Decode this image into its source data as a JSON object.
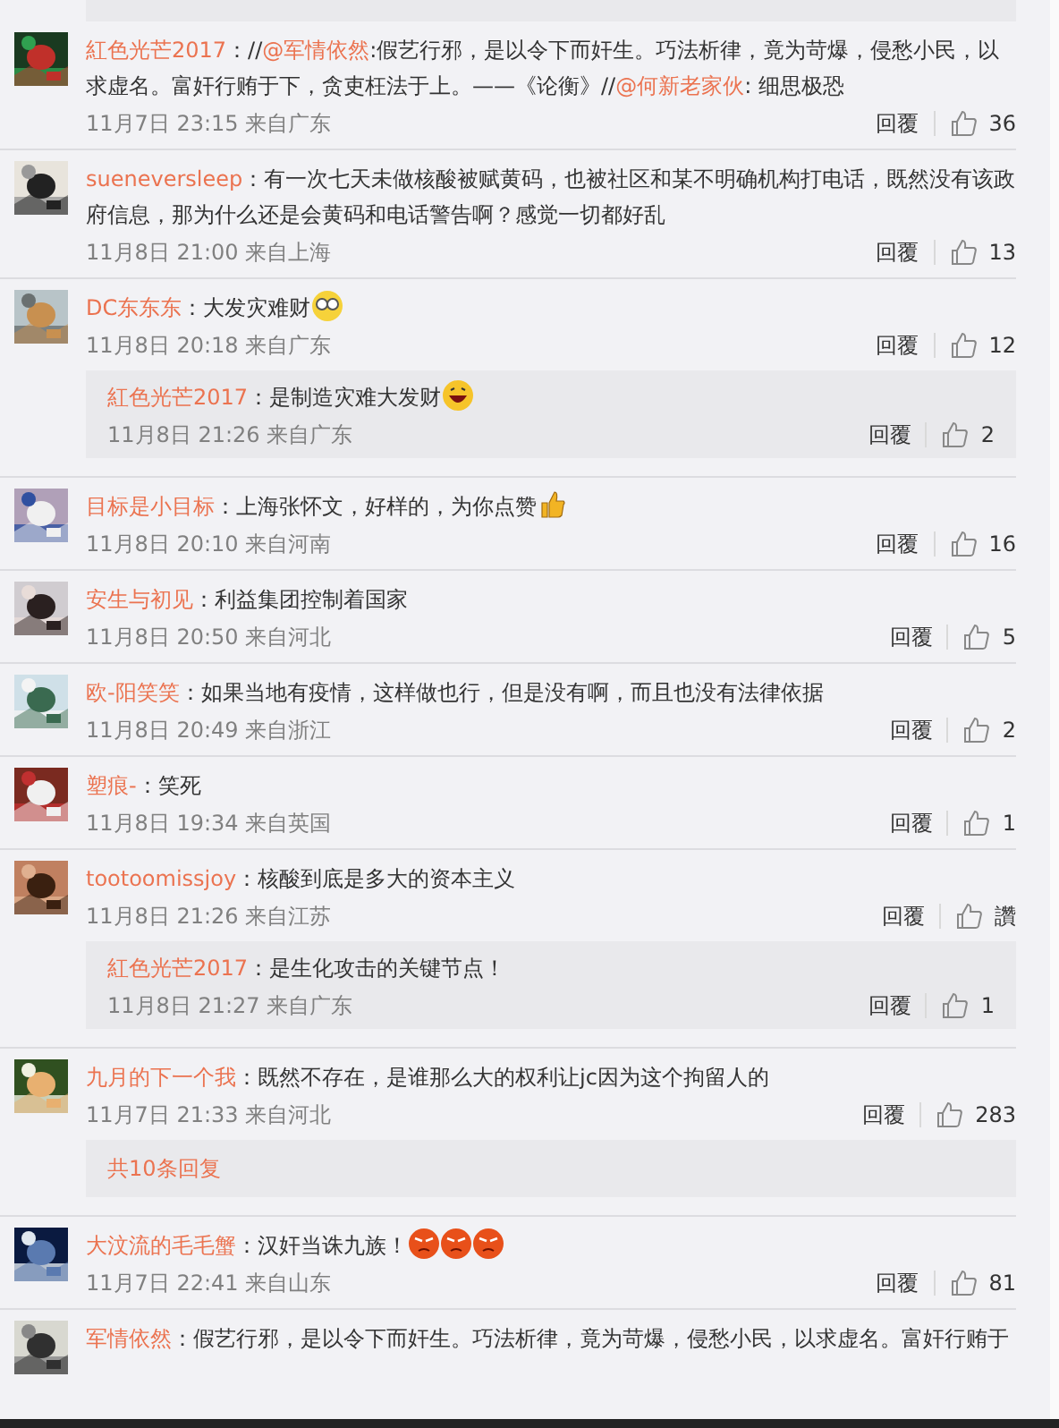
{
  "comments": [
    {
      "name": "紅色光芒2017",
      "segments": [
        {
          "kind": "plain",
          "text": "：//"
        },
        {
          "kind": "mention",
          "text": "@军情依然"
        },
        {
          "kind": "plain",
          "text": ":假艺行邪，是以令下而奸生。巧法析律，竟为苛爆，侵愁小民，以求虚名。富奸行贿于下，贪吏枉法于上。——《论衡》//"
        },
        {
          "kind": "mention",
          "text": "@何新老家伙"
        },
        {
          "kind": "plain",
          "text": ": 细思极恐"
        }
      ],
      "time": "11月7日 23:15 来自广东",
      "reply": "回覆",
      "likes": "36"
    },
    {
      "name": "sueneversleep",
      "segments": [
        {
          "kind": "plain",
          "text": "：有一次七天未做核酸被赋黄码，也被社区和某不明确机构打电话，既然没有该政府信息，那为什么还是会黄码和电话警告啊？感觉一切都好乱"
        }
      ],
      "time": "11月8日 21:00 来自上海",
      "reply": "回覆",
      "likes": "13"
    },
    {
      "name": "DC东东东",
      "segments": [
        {
          "kind": "plain",
          "text": "：大发灾难财"
        },
        {
          "kind": "glasses"
        }
      ],
      "time": "11月8日 20:18 来自广东",
      "reply": "回覆",
      "likes": "12",
      "replies": [
        {
          "name": "紅色光芒2017",
          "segments": [
            {
              "kind": "plain",
              "text": "：是制造灾难大发财"
            },
            {
              "kind": "laugh"
            }
          ],
          "time": "11月8日 21:26 来自广东",
          "reply": "回覆",
          "likes": "2"
        }
      ]
    },
    {
      "name": "目标是小目标",
      "segments": [
        {
          "kind": "plain",
          "text": "：上海张怀文，好样的，为你点赞"
        },
        {
          "kind": "thumb"
        }
      ],
      "time": "11月8日 20:10 来自河南",
      "reply": "回覆",
      "likes": "16"
    },
    {
      "name": "安生与初见",
      "segments": [
        {
          "kind": "plain",
          "text": "：利益集团控制着国家"
        }
      ],
      "time": "11月8日 20:50 来自河北",
      "reply": "回覆",
      "likes": "5"
    },
    {
      "name": "欧-阳笑笑",
      "segments": [
        {
          "kind": "plain",
          "text": "：如果当地有疫情，这样做也行，但是没有啊，而且也没有法律依据"
        }
      ],
      "time": "11月8日 20:49 来自浙江",
      "reply": "回覆",
      "likes": "2"
    },
    {
      "name": "塑痕-",
      "segments": [
        {
          "kind": "plain",
          "text": "：笑死"
        }
      ],
      "time": "11月8日 19:34 来自英国",
      "reply": "回覆",
      "likes": "1"
    },
    {
      "name": "tootoomissjoy",
      "segments": [
        {
          "kind": "plain",
          "text": "：核酸到底是多大的资本主义"
        }
      ],
      "time": "11月8日 21:26 来自江苏",
      "reply": "回覆",
      "likes": "讚",
      "replies": [
        {
          "name": "紅色光芒2017",
          "segments": [
            {
              "kind": "plain",
              "text": "：是生化攻击的关键节点！"
            }
          ],
          "time": "11月8日 21:27 来自广东",
          "reply": "回覆",
          "likes": "1"
        }
      ]
    },
    {
      "name": "九月的下一个我",
      "segments": [
        {
          "kind": "plain",
          "text": "：既然不存在，是谁那么大的权利让jc因为这个拘留人的"
        }
      ],
      "time": "11月7日 21:33 来自河北",
      "reply": "回覆",
      "likes": "283",
      "more_replies": "共10条回复"
    },
    {
      "name": "大汶流的毛毛蟹",
      "segments": [
        {
          "kind": "plain",
          "text": "：汉奸当诛九族！"
        },
        {
          "kind": "angry"
        },
        {
          "kind": "angry"
        },
        {
          "kind": "angry"
        }
      ],
      "time": "11月7日 22:41 来自山东",
      "reply": "回覆",
      "likes": "81"
    },
    {
      "name": "军情依然",
      "segments": [
        {
          "kind": "plain",
          "text": "：假艺行邪，是以令下而奸生。巧法析律，竟为苛爆，侵愁小民，以求虚名。富奸行贿于"
        }
      ]
    }
  ]
}
